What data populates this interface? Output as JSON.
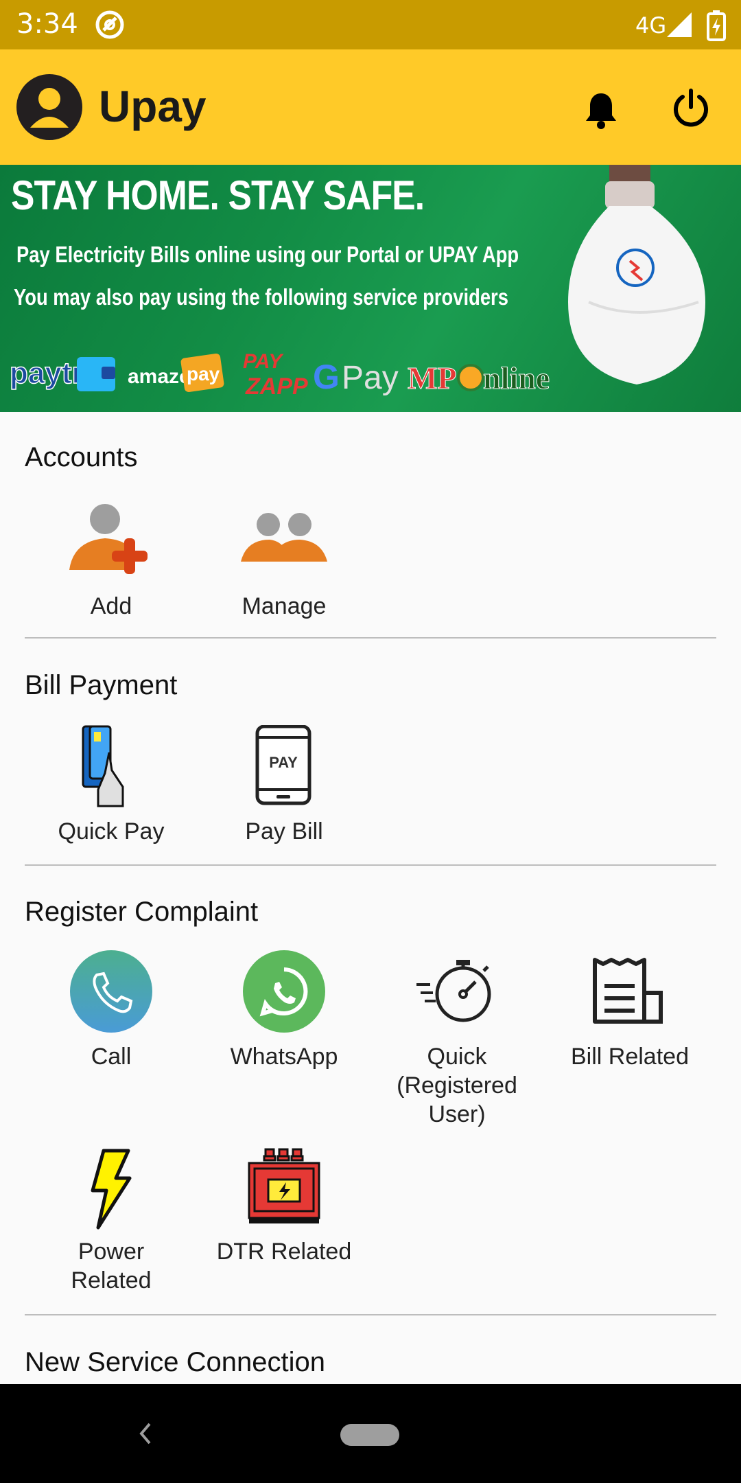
{
  "status_bar": {
    "time": "3:34",
    "network": "4G",
    "icons": [
      "app-notification-icon",
      "signal-icon",
      "battery-charging-icon"
    ]
  },
  "toolbar": {
    "title": "Upay",
    "icons": [
      "avatar-icon",
      "bell-icon",
      "power-icon"
    ]
  },
  "banner": {
    "headline": "STAY HOME. STAY SAFE.",
    "line1": "Pay Electricity Bills online using our Portal or UPAY App",
    "line2": "You may also pay using the following service providers",
    "providers": [
      "Paytm",
      "amazon pay",
      "PAYZAPP",
      "G Pay",
      "MPOnline"
    ]
  },
  "accounts": {
    "title": "Accounts",
    "items": [
      {
        "label": "Add",
        "icon": "add-user-icon"
      },
      {
        "label": "Manage",
        "icon": "manage-users-icon"
      }
    ]
  },
  "bill_payment": {
    "title": "Bill Payment",
    "items": [
      {
        "label": "Quick Pay",
        "icon": "card-pay-icon"
      },
      {
        "label": "Pay Bill",
        "icon": "phone-pay-icon"
      }
    ]
  },
  "register_complaint": {
    "title": "Register Complaint",
    "items": [
      {
        "label": "Call",
        "icon": "phone-icon"
      },
      {
        "label": "WhatsApp",
        "icon": "whatsapp-icon"
      },
      {
        "label": "Quick (Registered User)",
        "icon": "stopwatch-icon"
      },
      {
        "label": "Bill Related",
        "icon": "bill-icon"
      },
      {
        "label": "Power Related",
        "icon": "lightning-icon"
      },
      {
        "label": "DTR Related",
        "icon": "transformer-icon"
      }
    ]
  },
  "new_service": {
    "title": "New Service Connection"
  },
  "colors": {
    "status_bar": "#c89b00",
    "toolbar": "#ffca28",
    "accent_orange": "#e67e22",
    "banner_green": "#128c45"
  }
}
